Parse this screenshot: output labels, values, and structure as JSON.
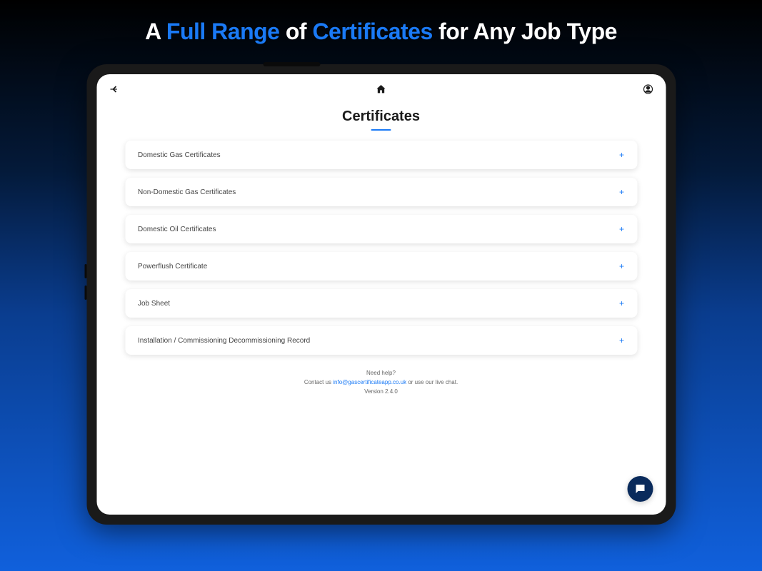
{
  "headline": {
    "part1": "A ",
    "highlight1": "Full Range",
    "part2": " of ",
    "highlight2": "Certificates",
    "part3": " for Any Job Type"
  },
  "screen": {
    "title": "Certificates",
    "certificates": [
      "Domestic Gas Certificates",
      "Non-Domestic Gas Certificates",
      "Domestic Oil Certificates",
      "Powerflush Certificate",
      "Job Sheet",
      "Installation / Commissioning Decommissioning Record"
    ],
    "footer": {
      "help_label": "Need help?",
      "contact_prefix": "Contact us ",
      "email": "info@gascertificateapp.co.uk",
      "contact_suffix": " or use our live chat.",
      "version": "Version 2.4.0"
    }
  }
}
